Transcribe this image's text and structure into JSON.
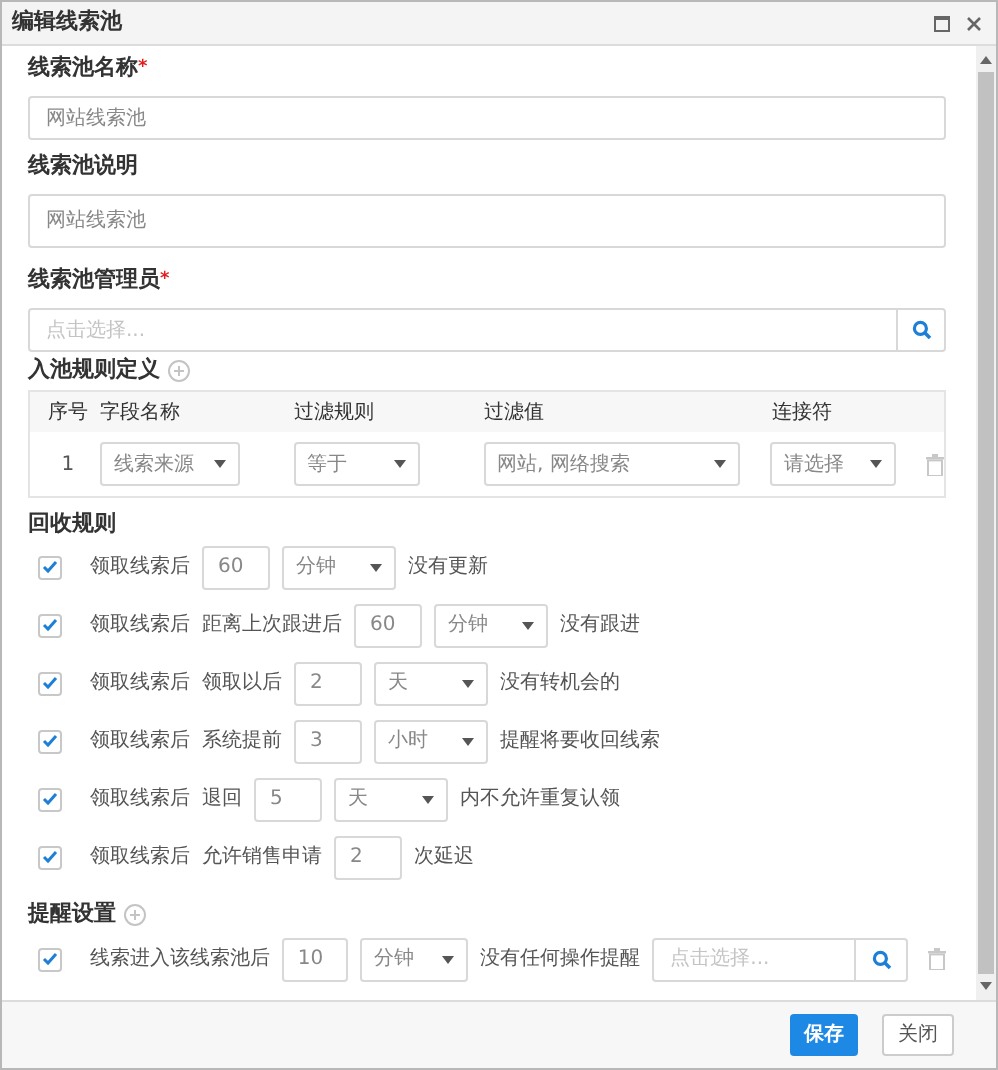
{
  "window": {
    "title": "编辑线索池"
  },
  "name_field": {
    "label": "线索池名称",
    "required_mark": "*",
    "value": "网站线索池"
  },
  "description_field": {
    "label": "线索池说明",
    "value": "网站线索池"
  },
  "manager_field": {
    "label": "线索池管理员",
    "required_mark": "*",
    "placeholder": "点击选择..."
  },
  "entry_rules": {
    "title": "入池规则定义",
    "columns": [
      "序号",
      "字段名称",
      "过滤规则",
      "过滤值",
      "连接符"
    ],
    "rows": [
      {
        "index": "1",
        "field": "线索来源",
        "rule": "等于",
        "value": "网站, 网络搜索",
        "connector": "请选择"
      }
    ]
  },
  "recycle_rules": {
    "title": "回收规则",
    "rows": [
      {
        "checked": true,
        "parts": [
          {
            "kind": "text",
            "text": "领取线索后"
          },
          {
            "kind": "number",
            "value": "60"
          },
          {
            "kind": "select",
            "value": "分钟"
          },
          {
            "kind": "text",
            "text": "没有更新"
          }
        ]
      },
      {
        "checked": true,
        "parts": [
          {
            "kind": "text",
            "text": "领取线索后"
          },
          {
            "kind": "text",
            "text": "距离上次跟进后"
          },
          {
            "kind": "number",
            "value": "60"
          },
          {
            "kind": "select",
            "value": "分钟"
          },
          {
            "kind": "text",
            "text": "没有跟进"
          }
        ]
      },
      {
        "checked": true,
        "parts": [
          {
            "kind": "text",
            "text": "领取线索后"
          },
          {
            "kind": "text",
            "text": "领取以后"
          },
          {
            "kind": "number",
            "value": "2"
          },
          {
            "kind": "select",
            "value": "天"
          },
          {
            "kind": "text",
            "text": "没有转机会的"
          }
        ]
      },
      {
        "checked": true,
        "parts": [
          {
            "kind": "text",
            "text": "领取线索后"
          },
          {
            "kind": "text",
            "text": "系统提前"
          },
          {
            "kind": "number",
            "value": "3"
          },
          {
            "kind": "select",
            "value": "小时"
          },
          {
            "kind": "text",
            "text": "提醒将要收回线索"
          }
        ]
      },
      {
        "checked": true,
        "parts": [
          {
            "kind": "text",
            "text": "领取线索后"
          },
          {
            "kind": "text",
            "text": "退回"
          },
          {
            "kind": "number",
            "value": "5"
          },
          {
            "kind": "select",
            "value": "天"
          },
          {
            "kind": "text",
            "text": "内不允许重复认领"
          }
        ]
      },
      {
        "checked": true,
        "parts": [
          {
            "kind": "text",
            "text": "领取线索后"
          },
          {
            "kind": "text",
            "text": "允许销售申请"
          },
          {
            "kind": "number",
            "value": "2"
          },
          {
            "kind": "text",
            "text": "次延迟"
          }
        ]
      }
    ]
  },
  "reminder_settings": {
    "title": "提醒设置",
    "rows": [
      {
        "checked": true,
        "parts": [
          {
            "kind": "text",
            "text": "线索进入该线索池后"
          },
          {
            "kind": "number",
            "value": "10"
          },
          {
            "kind": "select",
            "value": "分钟"
          },
          {
            "kind": "text",
            "text": "没有任何操作提醒"
          },
          {
            "kind": "picker",
            "placeholder": "点击选择..."
          },
          {
            "kind": "delete"
          }
        ]
      }
    ]
  },
  "buttons": [
    {
      "label": "保存",
      "kind": "primary"
    },
    {
      "label": "关闭",
      "kind": "default"
    }
  ]
}
